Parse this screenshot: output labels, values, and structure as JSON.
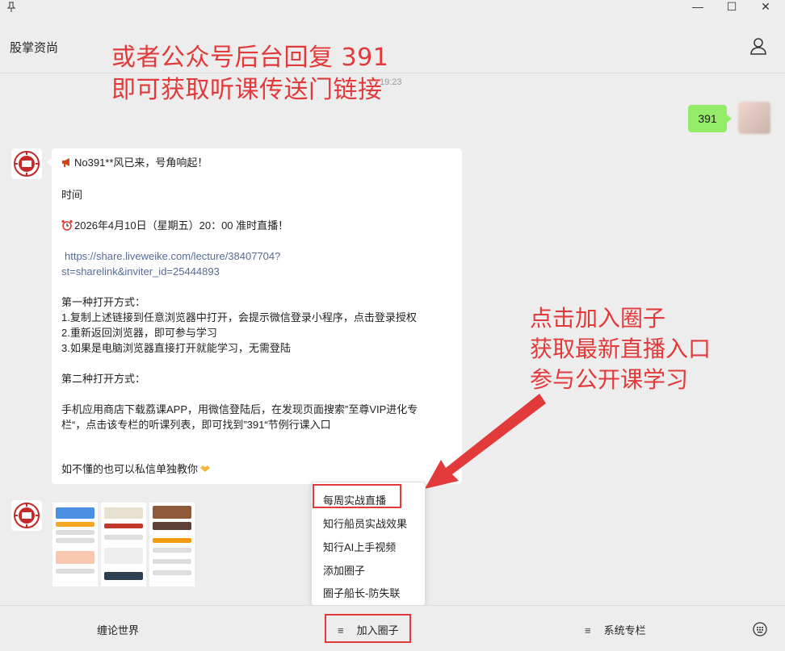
{
  "window": {
    "pin_icon": "pin-icon",
    "minimize": "—",
    "maximize": "☐",
    "close": "✕"
  },
  "header": {
    "title": "股掌资尚",
    "profile_icon": "person-icon"
  },
  "annotations": {
    "top_line1": "或者公众号后台回复 391",
    "top_line2": "即可获取听课传送门链接",
    "right_line1": "点击加入圈子",
    "right_line2": "获取最新直播入口",
    "right_line3": "参与公开课学习",
    "color": "#e23a3a"
  },
  "chat": {
    "timestamp": "19:23",
    "sent_message": "391",
    "card": {
      "line1": "No391**风已来，号角响起！",
      "line2": "时间",
      "line3": "2026年4月10日（星期五）20：00 准时直播！",
      "link1": "https://share.liveweike.com/lecture/38407704?",
      "link2": "st=sharelink&inviter_id=25444893",
      "m1_title": "第一种打开方式：",
      "m1_s1": "1.复制上述链接到任意浏览器中打开，会提示微信登录小程序，点击登录授权",
      "m1_s2": "2.重新返回浏览器，即可参与学习",
      "m1_s3": "3.如果是电脑浏览器直接打开就能学习，无需登陆",
      "m2_title": " 第二种打开方式：",
      "m2_l1": "手机应用商店下载荔课APP，用微信登陆后，在发现页面搜索”至尊VIP进化专",
      "m2_l2": "栏“，点击该专栏的听课列表，即可找到”391“节例行课入口",
      "closing": "如不懂的也可以私信单独教你"
    }
  },
  "menu_popup": {
    "items": [
      "每周实战直播",
      "知行船员实战效果",
      "知行AI上手视频",
      "添加圈子",
      "圈子船长-防失联"
    ]
  },
  "bottom_bar": {
    "item1": "缠论世界",
    "item2": "加入圈子",
    "item3": "系统专栏",
    "keyboard_icon": "keyboard-icon"
  }
}
